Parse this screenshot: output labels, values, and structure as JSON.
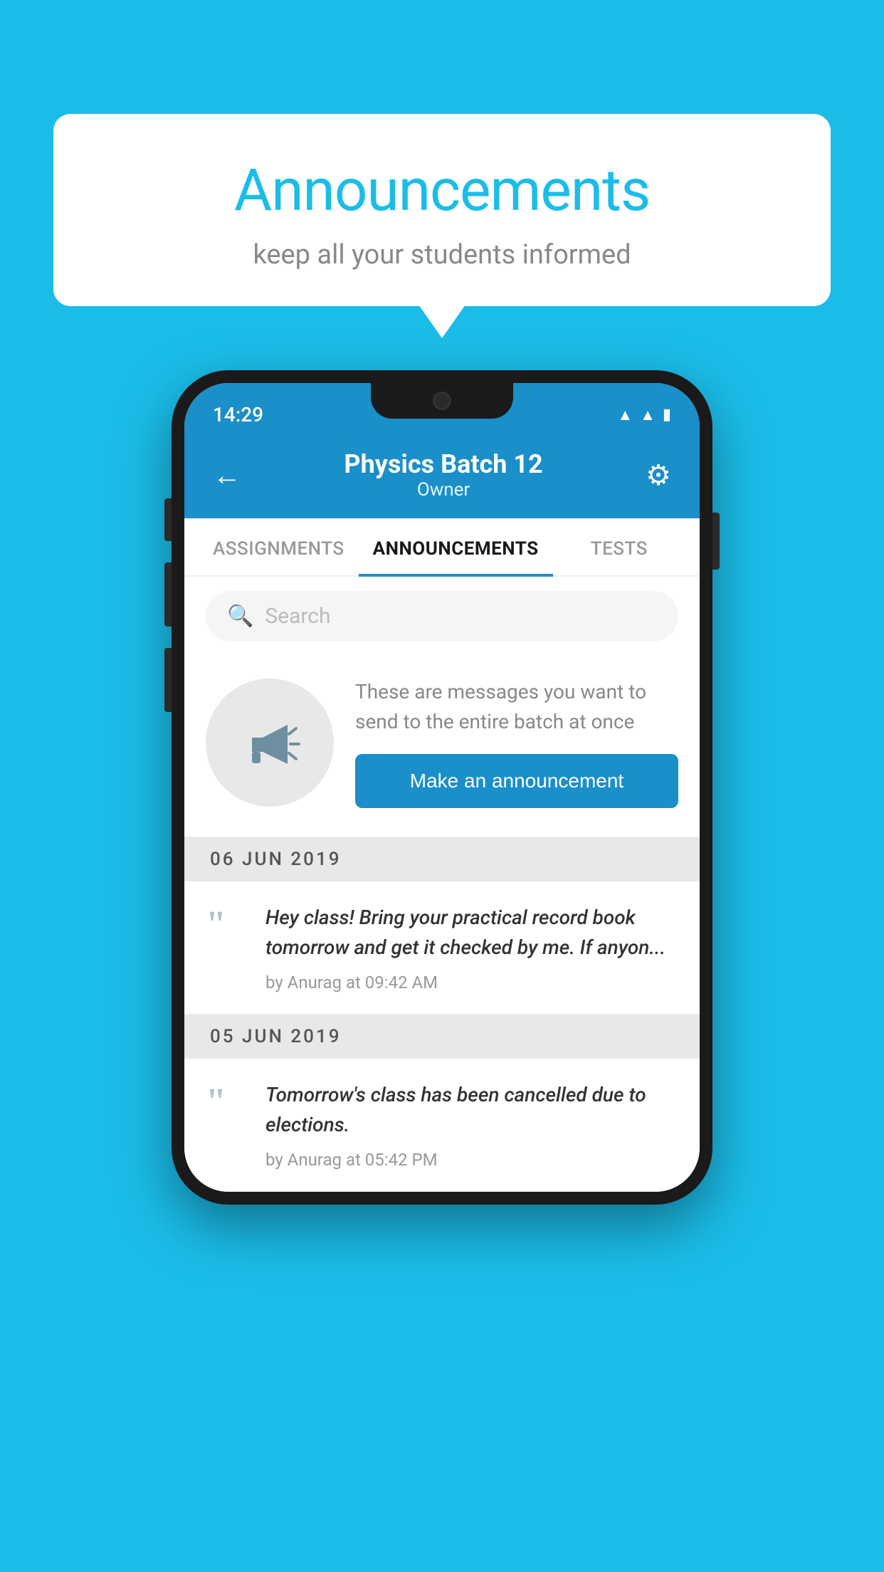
{
  "background": {
    "color": "#1bbde8"
  },
  "speech_bubble": {
    "title": "Announcements",
    "subtitle": "keep all your students informed"
  },
  "phone": {
    "status_bar": {
      "time": "14:29",
      "icons": [
        "wifi",
        "signal",
        "battery"
      ]
    },
    "app_bar": {
      "title": "Physics Batch 12",
      "subtitle": "Owner",
      "back_icon": "←",
      "gear_icon": "⚙"
    },
    "tabs": [
      {
        "label": "ASSIGNMENTS",
        "active": false
      },
      {
        "label": "ANNOUNCEMENTS",
        "active": true
      },
      {
        "label": "TESTS",
        "active": false
      },
      {
        "label": "...",
        "active": false
      }
    ],
    "search": {
      "placeholder": "Search"
    },
    "promo": {
      "description": "These are messages you want to send to the entire batch at once",
      "button_label": "Make an announcement"
    },
    "announcements": [
      {
        "date": "06  JUN  2019",
        "items": [
          {
            "text": "Hey class! Bring your practical record book tomorrow and get it checked by me. If anyon...",
            "meta": "by Anurag at 09:42 AM"
          }
        ]
      },
      {
        "date": "05  JUN  2019",
        "items": [
          {
            "text": "Tomorrow's class has been cancelled due to elections.",
            "meta": "by Anurag at 05:42 PM"
          }
        ]
      }
    ]
  }
}
